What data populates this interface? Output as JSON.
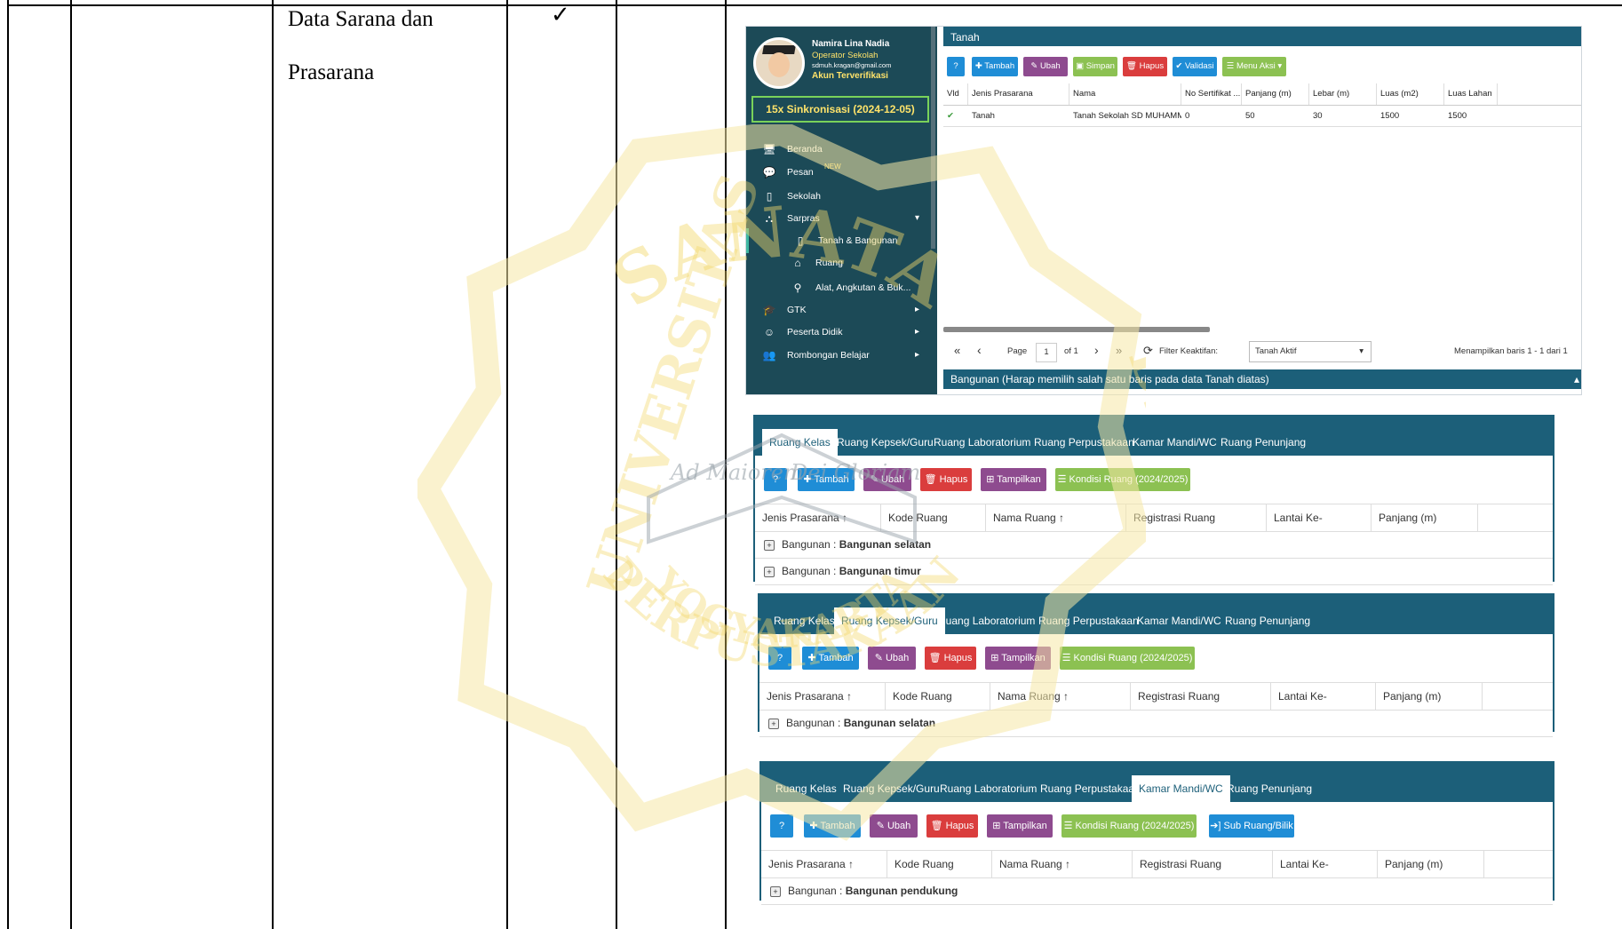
{
  "doc": {
    "row_label_line1": "Data Sarana dan",
    "row_label_line2": "Prasarana",
    "check": "✓"
  },
  "watermark": {
    "top_text": "SANATA",
    "left_text": "UNIVERSITAS",
    "right_text": "DHARMA",
    "bottom_text": "PERPUSTAKAAN",
    "bottom_text2": "YOGYAKARTA",
    "motto1": "Ad Maiorem",
    "motto2": "Dei Gloriam"
  },
  "shot1": {
    "user_name": "Namira Lina Nadia",
    "user_role": "Operator Sekolah",
    "user_email": "sdmuh.kragan@gmail.com",
    "verified": "Akun Terverifikasi",
    "sync": "15x Sinkronisasi (2024-12-05)",
    "nav": [
      {
        "icon": "monitor-icon",
        "glyph": "🖥",
        "label": "Beranda"
      },
      {
        "icon": "chat-icon",
        "glyph": "💬",
        "label": "Pesan",
        "badge": "NEW"
      },
      {
        "icon": "building-icon",
        "glyph": "▯",
        "label": "Sekolah"
      },
      {
        "icon": "road-icon",
        "glyph": "⛬",
        "label": "Sarpras",
        "arrow": "▾"
      },
      {
        "icon": "building-icon",
        "glyph": "▯",
        "label": "Tanah & Bangunan",
        "sub": true,
        "active": true
      },
      {
        "icon": "home-icon",
        "glyph": "⌂",
        "label": "Ruang",
        "sub": true
      },
      {
        "icon": "motorcycle-icon",
        "glyph": "⚲",
        "label": "Alat, Angkutan & Buk...",
        "sub": true
      },
      {
        "icon": "graduation-cap-icon",
        "glyph": "🎓",
        "label": "GTK",
        "arrow": "▸"
      },
      {
        "icon": "smile-icon",
        "glyph": "☺",
        "label": "Peserta Didik",
        "arrow": "▸"
      },
      {
        "icon": "group-icon",
        "glyph": "👥",
        "label": "Rombongan Belajar",
        "arrow": "▸"
      }
    ],
    "title": "Tanah",
    "toolbar": [
      {
        "icon": "help-icon",
        "label": "?",
        "color": "#1f8dd6"
      },
      {
        "icon": "plus-icon",
        "label": "✚ Tambah",
        "color": "#1f8dd6"
      },
      {
        "icon": "pencil-icon",
        "label": "✎ Ubah",
        "color": "#8e4b8f"
      },
      {
        "icon": "save-icon",
        "label": "▣ Simpan",
        "color": "#8cc152"
      },
      {
        "icon": "trash-icon",
        "label": "🗑 Hapus",
        "color": "#da3d3d"
      },
      {
        "icon": "check-icon",
        "label": "✔ Validasi",
        "color": "#1f8dd6"
      },
      {
        "icon": "list-icon",
        "label": "☰ Menu Aksi ▾",
        "color": "#8cc152"
      }
    ],
    "columns": [
      "Vld",
      "Jenis Prasarana",
      "Nama",
      "No Sertifikat ...",
      "Panjang (m)",
      "Lebar (m)",
      "Luas (m2)",
      "Luas Lahan"
    ],
    "rows": [
      [
        "✔",
        "Tanah",
        "Tanah Sekolah SD MUHAMM...",
        "0",
        "50",
        "30",
        "1500",
        "1500"
      ]
    ],
    "pager": {
      "first": "«",
      "prev": "‹",
      "page_label": "Page",
      "page_value": "1",
      "of": "of 1",
      "next": "›",
      "last": "»",
      "refresh": "⟳",
      "filter_label": "Filter Keaktifan:",
      "filter_value": "Tanah Aktif",
      "filter_arrow": "▾",
      "summary": "Menampilkan baris 1 - 1 dari 1"
    },
    "footer": "Bangunan (Harap memilih salah satu baris pada data Tanah diatas)",
    "footer_arrow": "▴"
  },
  "panels": [
    {
      "tabs": [
        "Ruang Kelas",
        "Ruang Kepsek/Guru",
        "Ruang Laboratorium",
        "Ruang Perpustakaan",
        "Kamar Mandi/WC",
        "Ruang Penunjang"
      ],
      "active": 0,
      "buttons": [
        {
          "icon": "help-icon",
          "label": "?",
          "color": "#1f8dd6"
        },
        {
          "icon": "plus-icon",
          "label": "✚  Tambah",
          "color": "#1f8dd6"
        },
        {
          "icon": "pencil-icon",
          "label": "✎  Ubah",
          "color": "#8e4b8f"
        },
        {
          "icon": "trash-icon",
          "label": "🗑  Hapus",
          "color": "#da3d3d"
        },
        {
          "icon": "expand-icon",
          "label": "⊞  Tampilkan",
          "color": "#8e4b8f"
        },
        {
          "icon": "list-icon",
          "label": "☰  Kondisi Ruang (2024/2025)",
          "color": "#8cc152"
        }
      ],
      "columns": [
        "Jenis Prasarana  ↑",
        "Kode Ruang",
        "Nama Ruang  ↑",
        "Registrasi Ruang",
        "Lantai Ke-",
        "Panjang (m)"
      ],
      "groups": [
        {
          "prefix": "Bangunan : ",
          "name": "Bangunan selatan"
        },
        {
          "prefix": "Bangunan : ",
          "name": "Bangunan timur"
        }
      ]
    },
    {
      "tabs": [
        "Ruang Kelas",
        "Ruang Kepsek/Guru",
        "Ruang Laboratorium",
        "Ruang Perpustakaan",
        "Kamar Mandi/WC",
        "Ruang Penunjang"
      ],
      "active": 1,
      "buttons": [
        {
          "icon": "help-icon",
          "label": "?",
          "color": "#1f8dd6"
        },
        {
          "icon": "plus-icon",
          "label": "✚  Tambah",
          "color": "#1f8dd6"
        },
        {
          "icon": "pencil-icon",
          "label": "✎  Ubah",
          "color": "#8e4b8f"
        },
        {
          "icon": "trash-icon",
          "label": "🗑  Hapus",
          "color": "#da3d3d"
        },
        {
          "icon": "expand-icon",
          "label": "⊞  Tampilkan",
          "color": "#8e4b8f"
        },
        {
          "icon": "list-icon",
          "label": "☰  Kondisi Ruang (2024/2025)",
          "color": "#8cc152"
        }
      ],
      "columns": [
        "Jenis Prasarana  ↑",
        "Kode Ruang",
        "Nama Ruang  ↑",
        "Registrasi Ruang",
        "Lantai Ke-",
        "Panjang (m)"
      ],
      "groups": [
        {
          "prefix": "Bangunan : ",
          "name": "Bangunan selatan"
        }
      ]
    },
    {
      "tabs": [
        "Ruang Kelas",
        "Ruang Kepsek/Guru",
        "Ruang Laboratorium",
        "Ruang Perpustakaan",
        "Kamar Mandi/WC",
        "Ruang Penunjang"
      ],
      "active": 4,
      "buttons": [
        {
          "icon": "help-icon",
          "label": "?",
          "color": "#1f8dd6"
        },
        {
          "icon": "plus-icon",
          "label": "✚  Tambah",
          "color": "#1f8dd6"
        },
        {
          "icon": "pencil-icon",
          "label": "✎  Ubah",
          "color": "#8e4b8f"
        },
        {
          "icon": "trash-icon",
          "label": "🗑  Hapus",
          "color": "#da3d3d"
        },
        {
          "icon": "expand-icon",
          "label": "⊞  Tampilkan",
          "color": "#8e4b8f"
        },
        {
          "icon": "list-icon",
          "label": "☰  Kondisi Ruang (2024/2025)",
          "color": "#8cc152"
        },
        {
          "icon": "sign-in-icon",
          "label": "➔]  Sub Ruang/Bilik",
          "color": "#1f8dd6"
        }
      ],
      "columns": [
        "Jenis Prasarana  ↑",
        "Kode Ruang",
        "Nama Ruang  ↑",
        "Registrasi Ruang",
        "Lantai Ke-",
        "Panjang (m)"
      ],
      "groups": [
        {
          "prefix": "Bangunan : ",
          "name": "Bangunan pendukung"
        }
      ]
    }
  ]
}
